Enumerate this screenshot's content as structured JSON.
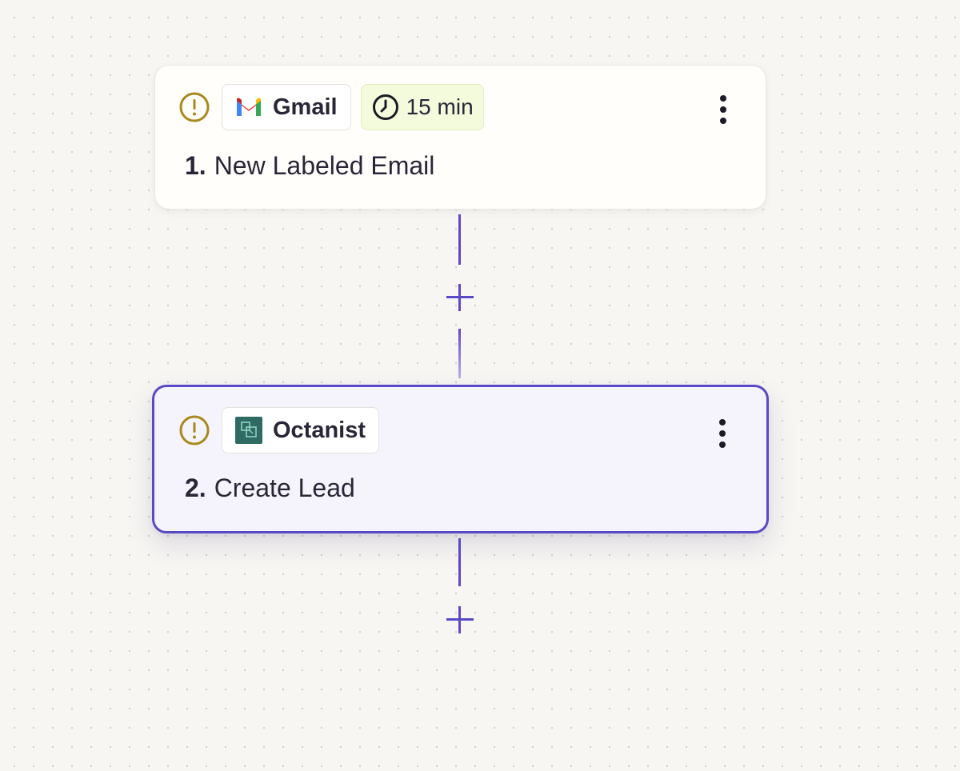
{
  "steps": [
    {
      "number": "1.",
      "title": "New Labeled Email",
      "app": {
        "name": "Gmail",
        "icon": "gmail-icon"
      },
      "polling": {
        "label": "15 min",
        "icon": "clock-icon"
      },
      "status_icon": "warning-icon",
      "menu_icon": "more-vertical-icon"
    },
    {
      "number": "2.",
      "title": "Create Lead",
      "app": {
        "name": "Octanist",
        "icon": "octanist-icon"
      },
      "status_icon": "warning-icon",
      "menu_icon": "more-vertical-icon",
      "selected": true
    }
  ],
  "add_step_icon": "plus-icon",
  "colors": {
    "accent": "#5a49c7",
    "warning": "#a8891b",
    "trigger_card_bg": "#fffefa",
    "selected_card_bg": "#f5f4fc",
    "poll_badge_bg": "#f3fbdc",
    "octanist_brand": "#2f6b62",
    "canvas_bg": "#f7f6f3"
  }
}
